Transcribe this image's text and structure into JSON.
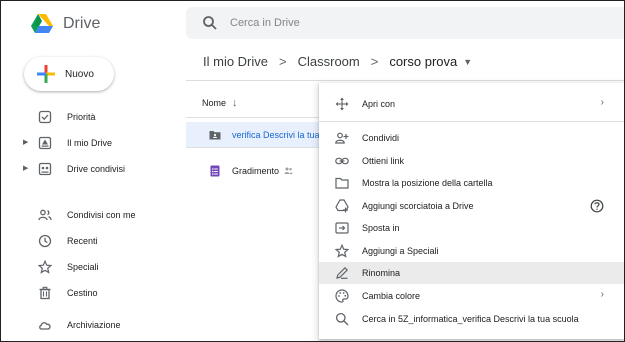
{
  "app": {
    "name": "Drive"
  },
  "search": {
    "placeholder": "Cerca in Drive"
  },
  "sidebar": {
    "new_label": "Nuovo",
    "items": [
      {
        "label": "Priorità",
        "icon": "priority-check-icon"
      },
      {
        "label": "Il mio Drive",
        "icon": "my-drive-icon",
        "expandable": true
      },
      {
        "label": "Drive condivisi",
        "icon": "shared-drives-icon",
        "expandable": true
      },
      {
        "label": "Condivisi con me",
        "icon": "people-icon"
      },
      {
        "label": "Recenti",
        "icon": "clock-icon"
      },
      {
        "label": "Speciali",
        "icon": "star-icon"
      },
      {
        "label": "Cestino",
        "icon": "trash-icon"
      },
      {
        "label": "Archiviazione",
        "icon": "cloud-icon"
      }
    ]
  },
  "breadcrumb": {
    "items": [
      "Il mio Drive",
      "Classroom",
      "corso prova"
    ],
    "separator": ">"
  },
  "file_list": {
    "column_header": "Nome",
    "sort_icon": "arrow-down-icon",
    "rows": [
      {
        "name": "verifica Descrivi la tua scuola",
        "icon": "shared-folder-icon",
        "selected": true
      },
      {
        "name": "Gradimento",
        "icon": "google-forms-icon",
        "shared": true
      }
    ]
  },
  "context_menu": {
    "items": [
      {
        "label": "Apri con",
        "icon": "open-with-icon",
        "right": "›"
      },
      {
        "label": "Condividi",
        "icon": "person-add-icon"
      },
      {
        "label": "Ottieni link",
        "icon": "link-icon"
      },
      {
        "label": "Mostra la posizione della cartella",
        "icon": "folder-outline-icon"
      },
      {
        "label": "Aggiungi scorciatoia a Drive",
        "icon": "add-shortcut-icon",
        "right": "?"
      },
      {
        "label": "Sposta in",
        "icon": "move-to-icon"
      },
      {
        "label": "Aggiungi a Speciali",
        "icon": "star-icon"
      },
      {
        "label": "Rinomina",
        "icon": "pencil-icon",
        "highlighted": true
      },
      {
        "label": "Cambia colore",
        "icon": "palette-icon",
        "right": "›"
      },
      {
        "label": "Cerca in 5Z_informatica_verifica Descrivi la tua scuola",
        "icon": "search-icon"
      }
    ]
  },
  "colors": {
    "selected_row_bg": "#e8f0fe",
    "selected_row_text": "#1967d2",
    "menu_highlight": "#ebebeb",
    "search_bg": "#f1f3f4",
    "forms_purple": "#7248b9"
  }
}
